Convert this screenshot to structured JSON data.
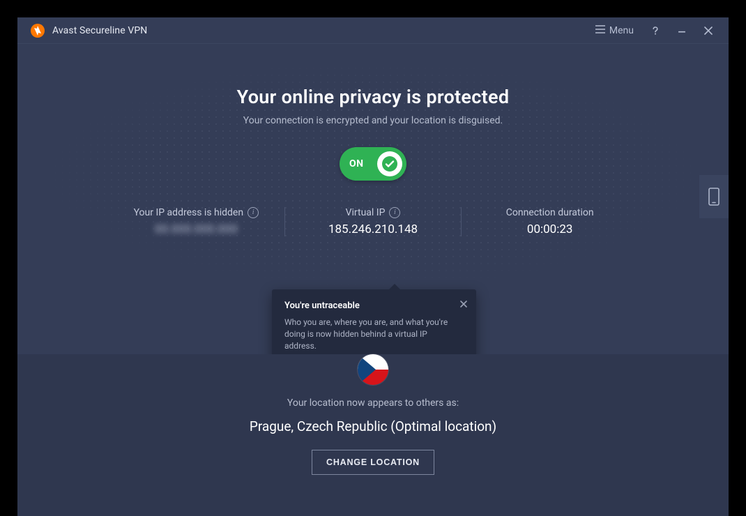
{
  "titlebar": {
    "app_name": "Avast Secureline VPN",
    "menu_label": "Menu"
  },
  "main": {
    "headline": "Your online privacy is protected",
    "subtitle": "Your connection is encrypted and your location is disguised.",
    "toggle": {
      "state_label": "ON"
    },
    "columns": {
      "ip_hidden": {
        "label": "Your IP address is hidden",
        "value_masked": "00.000.000.000"
      },
      "virtual_ip": {
        "label": "Virtual IP",
        "value": "185.246.210.148"
      },
      "duration": {
        "label": "Connection duration",
        "value": "00:00:23"
      }
    },
    "tooltip": {
      "title": "You're untraceable",
      "body": "Who you are, where you are, and what you're doing is now hidden behind a virtual IP address."
    }
  },
  "location": {
    "appears_label": "Your location now appears to others as:",
    "value": "Prague, Czech Republic (Optimal location)",
    "change_button": "CHANGE LOCATION"
  }
}
